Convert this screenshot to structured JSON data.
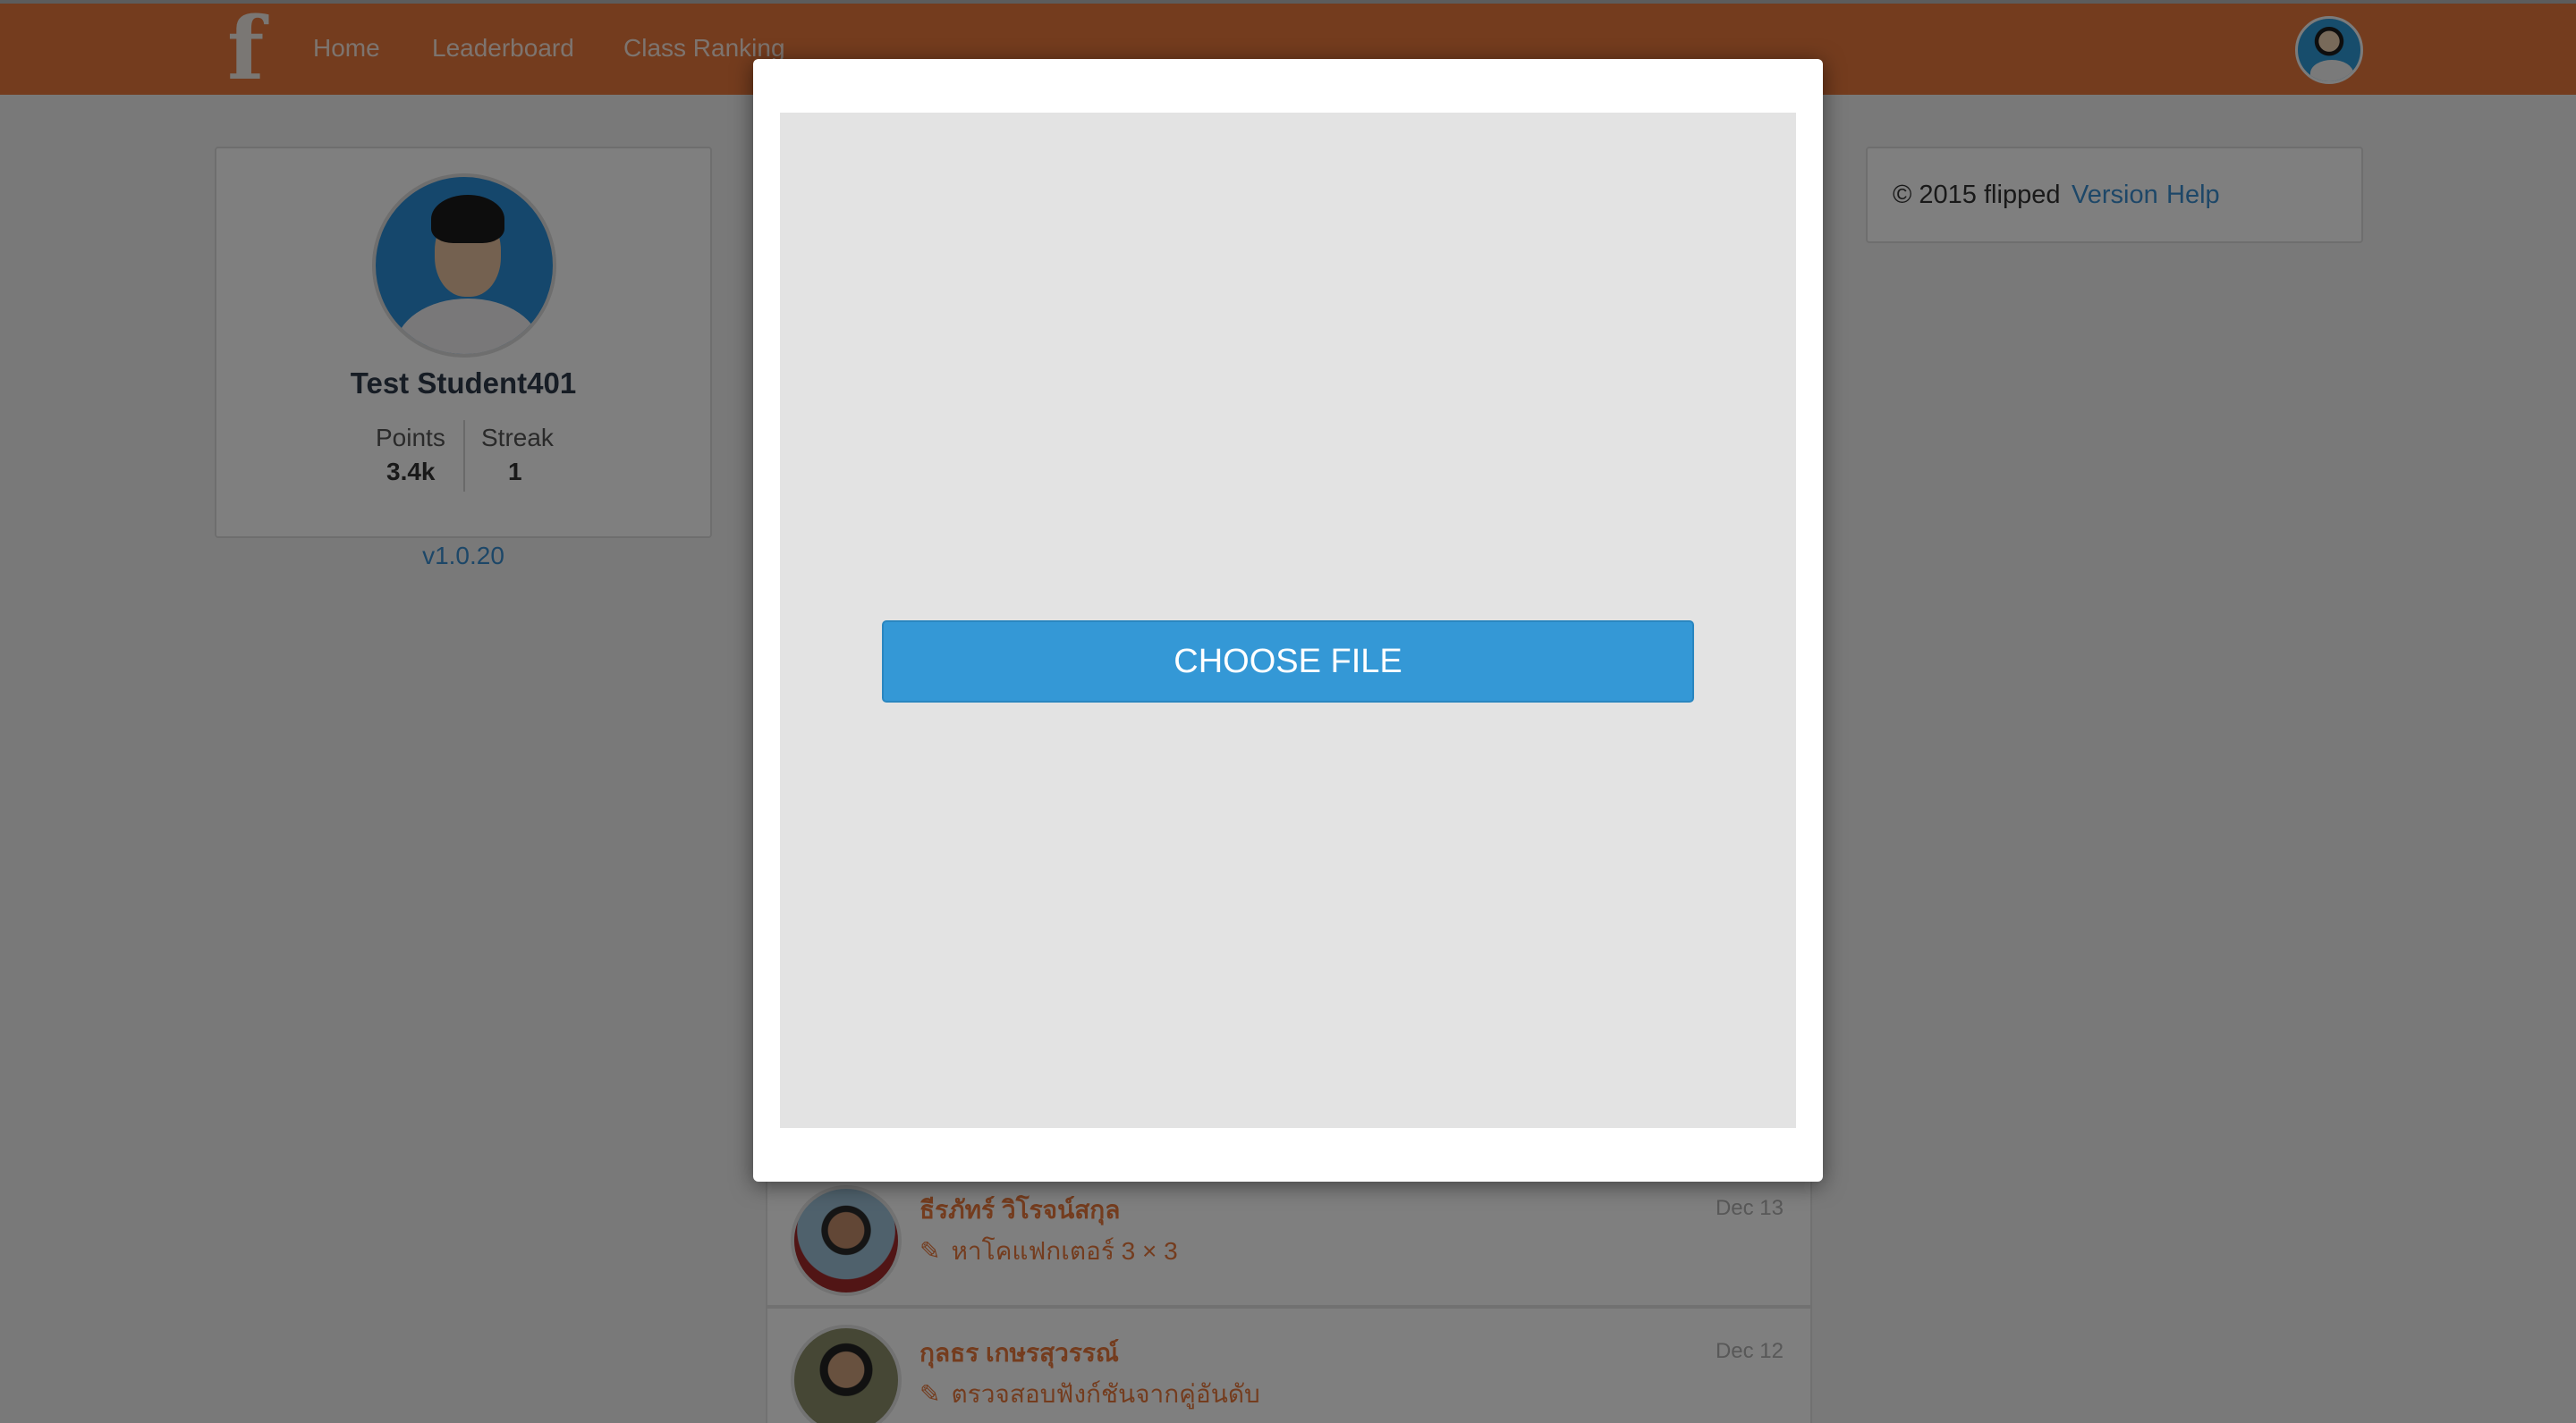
{
  "nav": {
    "logo": "f",
    "links": [
      "Home",
      "Leaderboard",
      "Class Ranking"
    ],
    "avatar_icon": "user-avatar-icon"
  },
  "profile": {
    "name": "Test Student401",
    "points_label": "Points",
    "points_value": "3.4k",
    "streak_label": "Streak",
    "streak_value": "1",
    "version": "v1.0.20"
  },
  "footer": {
    "copyright": "© 2015 flipped",
    "version_link": "Version",
    "help_link": "Help"
  },
  "feed": [
    {
      "name": "ธีรภัทร์ วิโรจน์สกุล",
      "description": "หาโคแฟกเตอร์ 3 × 3",
      "date": "Dec 13"
    },
    {
      "name": "กุลธร เกษรสุวรรณ์",
      "description": "ตรวจสอบฟังก์ชันจากคู่อันดับ",
      "date": "Dec 12"
    }
  ],
  "modal": {
    "choose_file_label": "CHOOSE FILE"
  },
  "colors": {
    "brand": "#e8793c",
    "button": "#3498d6",
    "link": "#3a8ed0",
    "overlay": "rgba(0,0,0,0.5)"
  }
}
